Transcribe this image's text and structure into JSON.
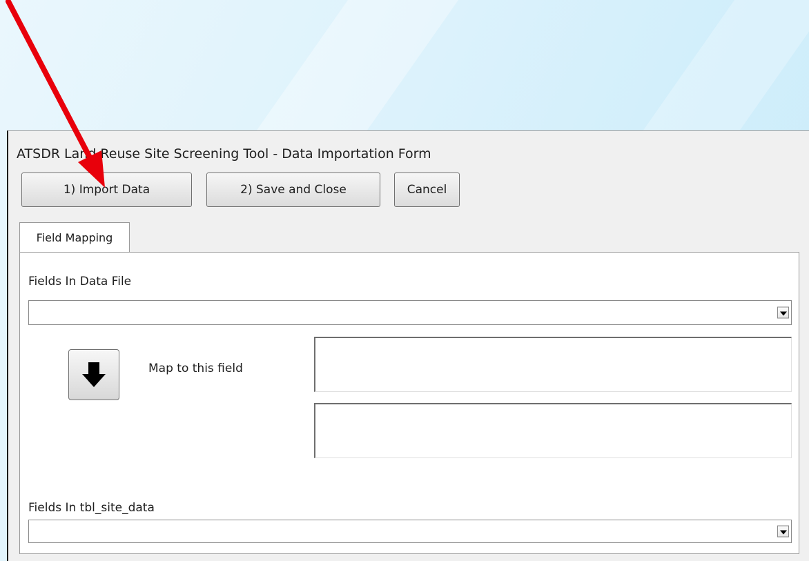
{
  "window": {
    "title": "ATSDR Land Reuse Site Screening Tool - Data Importation Form"
  },
  "toolbar": {
    "import_label": "1) Import  Data",
    "save_close_label": "2) Save and Close",
    "cancel_label": "Cancel"
  },
  "tabs": [
    {
      "label": "Field Mapping",
      "selected": true
    }
  ],
  "mapping": {
    "data_file_fields_label": "Fields In Data File",
    "data_file_fields_value": "",
    "map_label": "Map to this field",
    "map_button_icon": "down-arrow-icon",
    "target_field_value_1": "",
    "target_field_value_2": "",
    "table_fields_label": "Fields In tbl_site_data",
    "table_fields_value": ""
  },
  "annotation": {
    "arrow_icon": "red-pointer-arrow",
    "color": "#e8000b"
  }
}
